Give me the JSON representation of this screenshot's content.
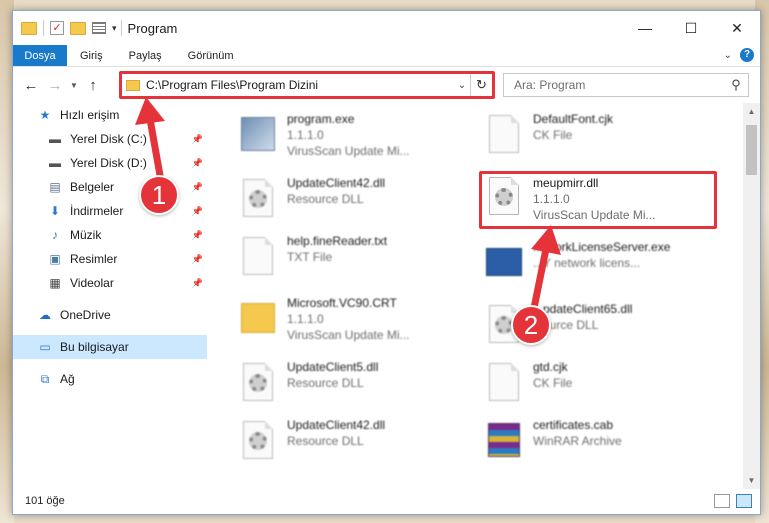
{
  "window": {
    "title": "Program",
    "controls": {
      "minimize": "—",
      "maximize": "☐",
      "close": "✕"
    }
  },
  "ribbon": {
    "tabs": [
      {
        "label": "Dosya"
      },
      {
        "label": "Giriş"
      },
      {
        "label": "Paylaş"
      },
      {
        "label": "Görünüm"
      }
    ]
  },
  "nav": {
    "address": "C:\\Program Files\\Program Dizini",
    "search_placeholder": "Ara: Program"
  },
  "sidebar": {
    "items": [
      {
        "label": "Hızlı erişim",
        "icon": "star-icon"
      },
      {
        "label": "Yerel Disk (C:)",
        "icon": "drive-icon",
        "pinned": true
      },
      {
        "label": "Yerel Disk (D:)",
        "icon": "drive-icon",
        "pinned": true
      },
      {
        "label": "Belgeler",
        "icon": "documents-icon",
        "pinned": true
      },
      {
        "label": "İndirmeler",
        "icon": "download-icon",
        "pinned": true
      },
      {
        "label": "Müzik",
        "icon": "music-icon",
        "pinned": true
      },
      {
        "label": "Resimler",
        "icon": "pictures-icon",
        "pinned": true
      },
      {
        "label": "Videolar",
        "icon": "videos-icon",
        "pinned": true
      },
      {
        "label": "OneDrive",
        "icon": "onedrive-icon"
      },
      {
        "label": "Bu bilgisayar",
        "icon": "computer-icon",
        "selected": true
      },
      {
        "label": "Ağ",
        "icon": "network-icon"
      }
    ],
    "pin_glyph": "📌"
  },
  "files": {
    "left": [
      {
        "name": "program.exe",
        "line2": "1.1.1.0",
        "line3": "VirusScan Update Mi...",
        "icon": "exe-icon"
      },
      {
        "name": "UpdateClient42.dll",
        "line2": "Resource DLL",
        "icon": "dll-icon"
      },
      {
        "name": "help.fineReader.txt",
        "line2": "TXT File",
        "icon": "text-file-icon"
      },
      {
        "name": "Microsoft.VC90.CRT",
        "line2": "1.1.1.0",
        "line3": "VirusScan Update Mi...",
        "icon": "folder-icon"
      },
      {
        "name": "UpdateClient5.dll",
        "line2": "Resource DLL",
        "icon": "dll-icon"
      },
      {
        "name": "UpdateClient42.dll",
        "line2": "Resource DLL",
        "icon": "dll-icon"
      }
    ],
    "right": [
      {
        "name": "DefaultFont.cjk",
        "line2": "CK File",
        "icon": "blank-file-icon"
      },
      {
        "name": "meupmirr.dll",
        "line2": "1.1.1.0",
        "line3": "VirusScan Update Mi...",
        "icon": "dll-icon",
        "highlighted": true
      },
      {
        "name": "...tworkLicenseServer.exe",
        "line2": "...Y network licens...",
        "icon": "network-exe-icon"
      },
      {
        "name": "...pdateClient65.dll",
        "line2": "...ource DLL",
        "icon": "dll-icon"
      },
      {
        "name": "gtd.cjk",
        "line2": "CK File",
        "icon": "blank-file-icon"
      },
      {
        "name": "certificates.cab",
        "line2": "WinRAR Archive",
        "icon": "winrar-icon"
      }
    ]
  },
  "status": {
    "count": "101 öğe"
  },
  "annotations": [
    {
      "label": "1"
    },
    {
      "label": "2"
    }
  ],
  "colors": {
    "accent": "#1979ca",
    "highlight": "#e5333a",
    "selection": "#cce8ff"
  }
}
